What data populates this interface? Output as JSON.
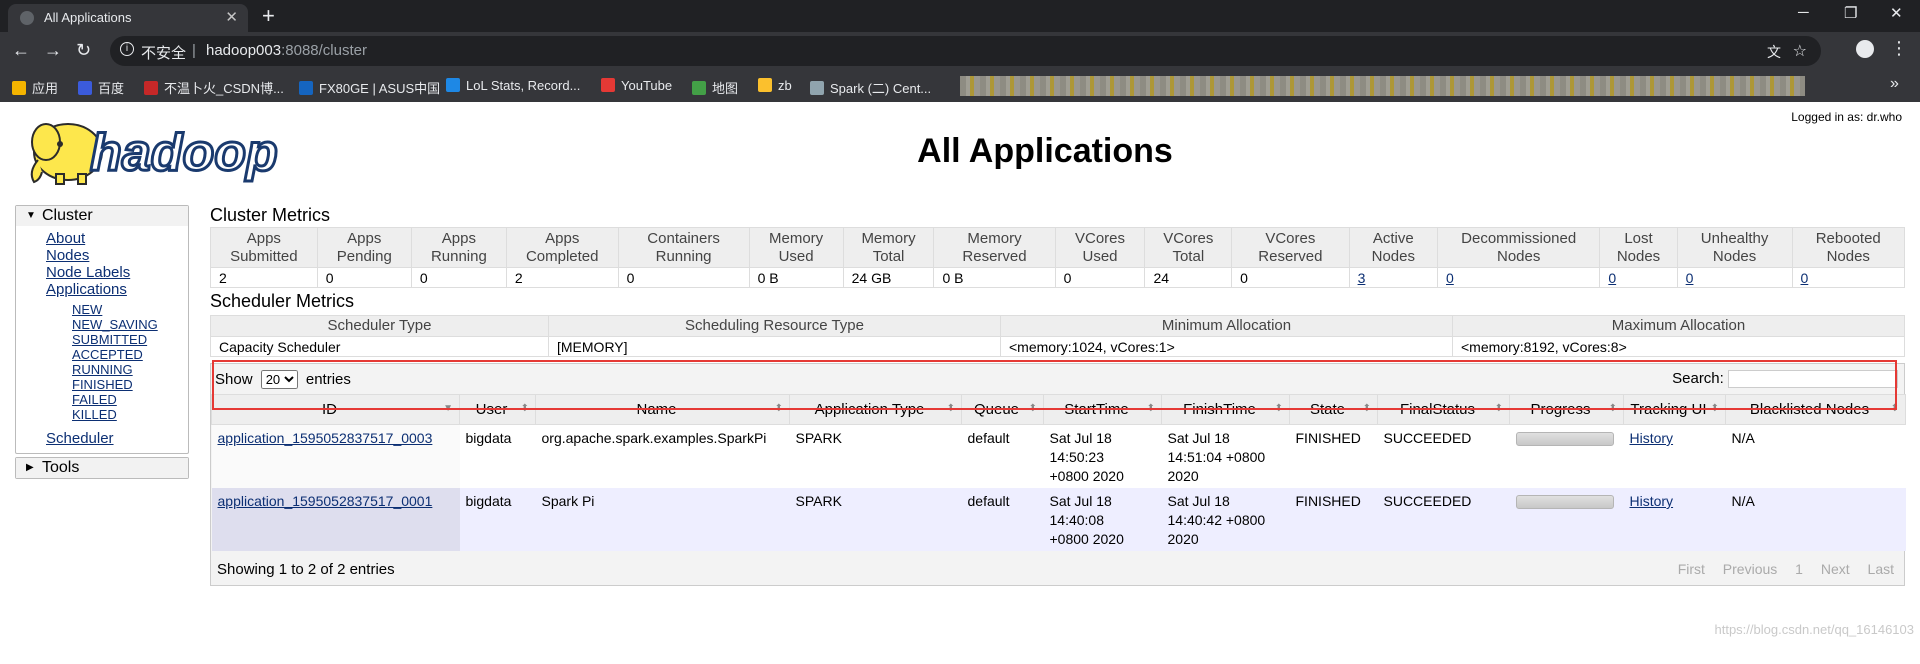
{
  "browser": {
    "tab_title": "All Applications",
    "tab_close": "✕",
    "new_tab": "+",
    "insecure_label": "不安全",
    "url_host": "hadoop003",
    "url_path": ":8088/cluster",
    "window_controls": [
      "─",
      "❐",
      "✕"
    ],
    "bookmarks": [
      {
        "label": "应用",
        "color": "#f4b400"
      },
      {
        "label": "百度",
        "color": "#3b5bdb"
      },
      {
        "label": "不温卜火_CSDN博...",
        "color": "#c62828"
      },
      {
        "label": "FX80GE | ASUS中国",
        "color": "#1565c0"
      },
      {
        "label": "LoL Stats, Record...",
        "color": "#1e88e5"
      },
      {
        "label": "YouTube",
        "color": "#e53935"
      },
      {
        "label": "地图",
        "color": "#43a047"
      },
      {
        "label": "zb",
        "color": "#fbc02d"
      },
      {
        "label": "Spark (二) Cent...",
        "color": "#90a4ae"
      }
    ],
    "bookmarks_more": "»"
  },
  "page": {
    "logged_in": "Logged in as: dr.who",
    "title": "All Applications",
    "logo_text": "hadoop"
  },
  "sidebar": {
    "cluster_label": "Cluster",
    "cluster_links": [
      "About",
      "Nodes",
      "Node Labels",
      "Applications"
    ],
    "app_states": [
      "NEW",
      "NEW_SAVING",
      "SUBMITTED",
      "ACCEPTED",
      "RUNNING",
      "FINISHED",
      "FAILED",
      "KILLED"
    ],
    "scheduler_link": "Scheduler",
    "tools_label": "Tools"
  },
  "cluster_metrics": {
    "title": "Cluster Metrics",
    "headers": [
      "Apps Submitted",
      "Apps Pending",
      "Apps Running",
      "Apps Completed",
      "Containers Running",
      "Memory Used",
      "Memory Total",
      "Memory Reserved",
      "VCores Used",
      "VCores Total",
      "VCores Reserved",
      "Active Nodes",
      "Decommissioned Nodes",
      "Lost Nodes",
      "Unhealthy Nodes",
      "Rebooted Nodes"
    ],
    "values": [
      "2",
      "0",
      "0",
      "2",
      "0",
      "0 B",
      "24 GB",
      "0 B",
      "0",
      "24",
      "0",
      "3",
      "0",
      "0",
      "0",
      "0"
    ]
  },
  "scheduler_metrics": {
    "title": "Scheduler Metrics",
    "headers": [
      "Scheduler Type",
      "Scheduling Resource Type",
      "Minimum Allocation",
      "Maximum Allocation"
    ],
    "values": [
      "Capacity Scheduler",
      "[MEMORY]",
      "<memory:1024, vCores:1>",
      "<memory:8192, vCores:8>"
    ]
  },
  "apps_table": {
    "show_label": "Show",
    "page_size": "20",
    "entries_label": "entries",
    "search_label": "Search:",
    "headers": [
      "ID",
      "User",
      "Name",
      "Application Type",
      "Queue",
      "StartTime",
      "FinishTime",
      "State",
      "FinalStatus",
      "Progress",
      "Tracking UI",
      "Blacklisted Nodes"
    ],
    "rows": [
      {
        "id": "application_1595052837517_0003",
        "user": "bigdata",
        "name": "org.apache.spark.examples.SparkPi",
        "type": "SPARK",
        "queue": "default",
        "start": [
          "Sat Jul 18",
          "14:50:23",
          "+0800 2020"
        ],
        "finish": [
          "Sat Jul 18",
          "14:51:04 +0800",
          "2020"
        ],
        "state": "FINISHED",
        "final_status": "SUCCEEDED",
        "progress": 1.0,
        "tracking": "History",
        "blacklisted": "N/A"
      },
      {
        "id": "application_1595052837517_0001",
        "user": "bigdata",
        "name": "Spark Pi",
        "type": "SPARK",
        "queue": "default",
        "start": [
          "Sat Jul 18",
          "14:40:08",
          "+0800 2020"
        ],
        "finish": [
          "Sat Jul 18",
          "14:40:42 +0800",
          "2020"
        ],
        "state": "FINISHED",
        "final_status": "SUCCEEDED",
        "progress": 1.0,
        "tracking": "History",
        "blacklisted": "N/A"
      }
    ],
    "footer_info": "Showing 1 to 2 of 2 entries",
    "pager": [
      "First",
      "Previous",
      "1",
      "Next",
      "Last"
    ]
  },
  "watermark": "https://blog.csdn.net/qq_16146103",
  "colors": {
    "link": "#0c2f73",
    "highlight": "#e53935",
    "row_alt": "#eeeeff"
  }
}
